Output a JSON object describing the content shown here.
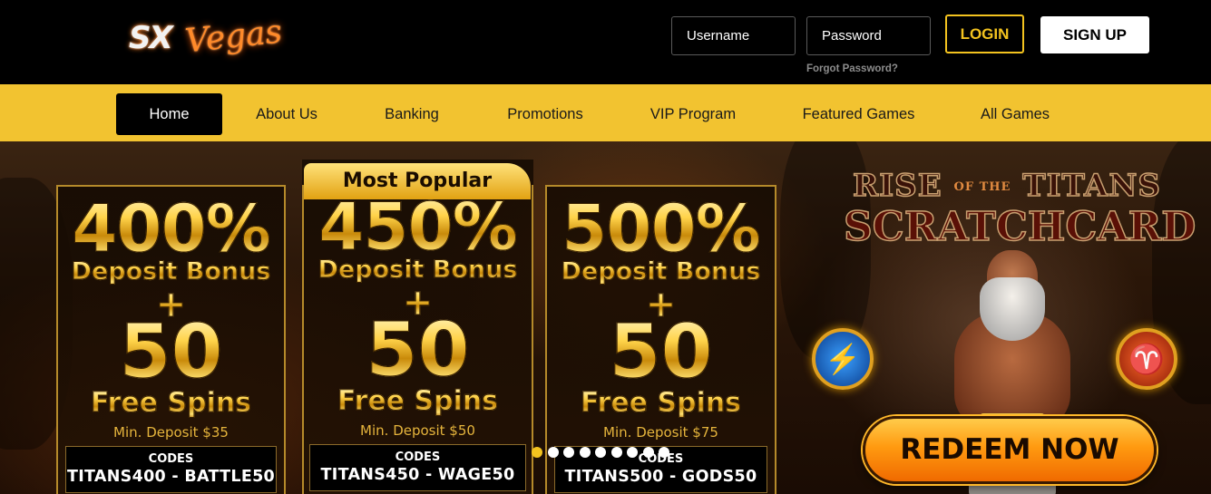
{
  "header": {
    "logo_text_sx": "SX",
    "logo_text_vegas": "Vegas",
    "username_placeholder": "Username",
    "password_placeholder": "Password",
    "forgot_password": "Forgot Password?",
    "login_label": "LOGIN",
    "signup_label": "SIGN UP"
  },
  "nav": {
    "items": [
      {
        "label": "Home",
        "active": true
      },
      {
        "label": "About Us"
      },
      {
        "label": "Banking"
      },
      {
        "label": "Promotions"
      },
      {
        "label": "VIP Program"
      },
      {
        "label": "Featured Games"
      },
      {
        "label": "All Games"
      }
    ]
  },
  "promos": [
    {
      "percent": "400%",
      "bonus": "Deposit Bonus",
      "plus": "+",
      "spins": "50",
      "spins_label": "Free Spins",
      "min_deposit": "Min. Deposit $35",
      "codes_label": "CODES",
      "codes": "TITANS400 - BATTLE50"
    },
    {
      "ribbon": "Most Popular",
      "percent": "450%",
      "bonus": "Deposit Bonus",
      "plus": "+",
      "spins": "50",
      "spins_label": "Free Spins",
      "min_deposit": "Min. Deposit $50",
      "codes_label": "CODES",
      "codes": "TITANS450 - WAGE50"
    },
    {
      "percent": "500%",
      "bonus": "Deposit Bonus",
      "plus": "+",
      "spins": "50",
      "spins_label": "Free Spins",
      "min_deposit": "Min. Deposit $75",
      "codes_label": "CODES",
      "codes": "TITANS500 - GODS50"
    }
  ],
  "carousel": {
    "dot_count": 9,
    "active_index": 0
  },
  "feature": {
    "title_rise": "RISE",
    "title_of_the": "OF THE",
    "title_titans": "TITANS",
    "title_scratchcard": "SCRATCHCARD",
    "redeem_label": "REDEEM NOW"
  },
  "colors": {
    "accent": "#f2c330",
    "login": "#f3c31f",
    "redeem": "#ff9a10"
  }
}
